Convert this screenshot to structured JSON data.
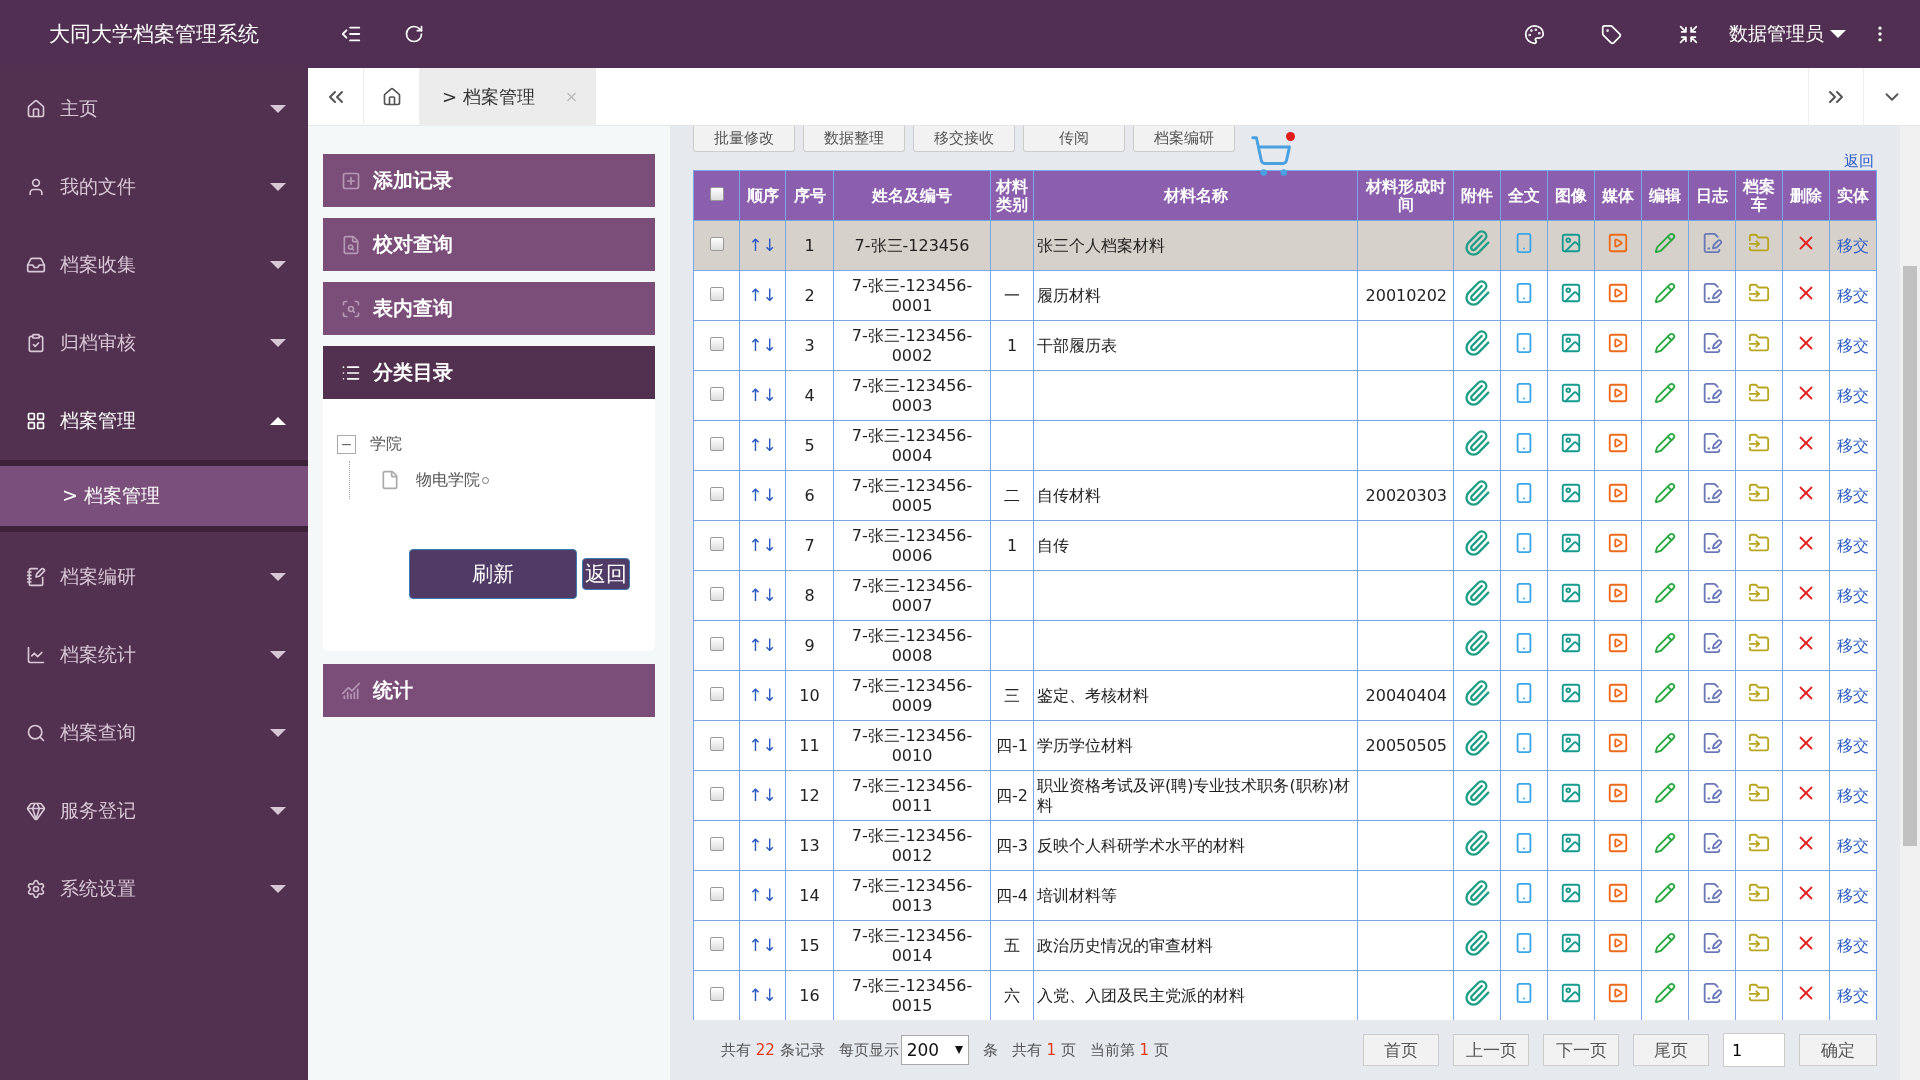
{
  "app_title": "大同大学档案管理系统",
  "user": "数据管理员",
  "sidebar": {
    "items": [
      {
        "label": "主页",
        "expanded": false
      },
      {
        "label": "我的文件",
        "expanded": false
      },
      {
        "label": "档案收集",
        "expanded": false
      },
      {
        "label": "归档审核",
        "expanded": false
      },
      {
        "label": "档案管理",
        "expanded": true,
        "children": [
          {
            "label": "> 档案管理",
            "selected": true
          }
        ]
      },
      {
        "label": "档案编研",
        "expanded": false
      },
      {
        "label": "档案统计",
        "expanded": false
      },
      {
        "label": "档案查询",
        "expanded": false
      },
      {
        "label": "服务登记",
        "expanded": false
      },
      {
        "label": "系统设置",
        "expanded": false
      }
    ]
  },
  "tabs": [
    {
      "label": "> 档案管理",
      "selected": true,
      "close": "×"
    }
  ],
  "panel": {
    "items": [
      {
        "label": "添加记录",
        "selected": false
      },
      {
        "label": "校对查询",
        "selected": false
      },
      {
        "label": "表内查询",
        "selected": false
      },
      {
        "label": "分类目录",
        "selected": true
      },
      {
        "label": "统计",
        "selected": false
      }
    ],
    "tree": [
      {
        "label": "学院",
        "toggle": "−",
        "children": [
          {
            "label": "物电学院"
          }
        ]
      }
    ],
    "buttons": [
      "刷新",
      "返回"
    ]
  },
  "toolbar": [
    "批量修改",
    "数据整理",
    "移交接收",
    "传阅",
    "档案编研"
  ],
  "back_link": "返回",
  "table": {
    "all_checked": false,
    "columns": [
      "顺序",
      "序号",
      "姓名及编号",
      "材料类别",
      "材料名称",
      "材料形成时间",
      "附件",
      "全文",
      "图像",
      "媒体",
      "编辑",
      "日志",
      "档案车",
      "删除",
      "实体"
    ],
    "rows": [
      {
        "selected": true,
        "checked": false,
        "order": "↑↓",
        "no": "1",
        "code": "7-张三-123456",
        "category": "",
        "name": "张三个人档案材料",
        "date": "",
        "action": "移交"
      },
      {
        "selected": false,
        "checked": false,
        "order": "↑↓",
        "no": "2",
        "code": "7-张三-123456-0001",
        "category": "一",
        "name": "履历材料",
        "date": "20010202",
        "action": "移交"
      },
      {
        "selected": false,
        "checked": false,
        "order": "↑↓",
        "no": "3",
        "code": "7-张三-123456-0002",
        "category": "1",
        "name": "干部履历表",
        "date": "",
        "action": "移交"
      },
      {
        "selected": false,
        "checked": false,
        "order": "↑↓",
        "no": "4",
        "code": "7-张三-123456-0003",
        "category": "",
        "name": "",
        "date": "",
        "action": "移交"
      },
      {
        "selected": false,
        "checked": false,
        "order": "↑↓",
        "no": "5",
        "code": "7-张三-123456-0004",
        "category": "",
        "name": "",
        "date": "",
        "action": "移交"
      },
      {
        "selected": false,
        "checked": false,
        "order": "↑↓",
        "no": "6",
        "code": "7-张三-123456-0005",
        "category": "二",
        "name": "自传材料",
        "date": "20020303",
        "action": "移交"
      },
      {
        "selected": false,
        "checked": false,
        "order": "↑↓",
        "no": "7",
        "code": "7-张三-123456-0006",
        "category": "1",
        "name": "自传",
        "date": "",
        "action": "移交"
      },
      {
        "selected": false,
        "checked": false,
        "order": "↑↓",
        "no": "8",
        "code": "7-张三-123456-0007",
        "category": "",
        "name": "",
        "date": "",
        "action": "移交"
      },
      {
        "selected": false,
        "checked": false,
        "order": "↑↓",
        "no": "9",
        "code": "7-张三-123456-0008",
        "category": "",
        "name": "",
        "date": "",
        "action": "移交"
      },
      {
        "selected": false,
        "checked": false,
        "order": "↑↓",
        "no": "10",
        "code": "7-张三-123456-0009",
        "category": "三",
        "name": "鉴定、考核材料",
        "date": "20040404",
        "action": "移交"
      },
      {
        "selected": false,
        "checked": false,
        "order": "↑↓",
        "no": "11",
        "code": "7-张三-123456-0010",
        "category": "四-1",
        "name": "学历学位材料",
        "date": "20050505",
        "action": "移交"
      },
      {
        "selected": false,
        "checked": false,
        "order": "↑↓",
        "no": "12",
        "code": "7-张三-123456-0011",
        "category": "四-2",
        "name": "职业资格考试及评(聘)专业技术职务(职称)材料",
        "date": "",
        "action": "移交"
      },
      {
        "selected": false,
        "checked": false,
        "order": "↑↓",
        "no": "13",
        "code": "7-张三-123456-0012",
        "category": "四-3",
        "name": "反映个人科研学术水平的材料",
        "date": "",
        "action": "移交"
      },
      {
        "selected": false,
        "checked": false,
        "order": "↑↓",
        "no": "14",
        "code": "7-张三-123456-0013",
        "category": "四-4",
        "name": "培训材料等",
        "date": "",
        "action": "移交"
      },
      {
        "selected": false,
        "checked": false,
        "order": "↑↓",
        "no": "15",
        "code": "7-张三-123456-0014",
        "category": "五",
        "name": "政治历史情况的审查材料",
        "date": "",
        "action": "移交"
      },
      {
        "selected": false,
        "checked": false,
        "order": "↑↓",
        "no": "16",
        "code": "7-张三-123456-0015",
        "category": "六",
        "name": "入党、入团及民主党派的材料",
        "date": "",
        "action": "移交"
      }
    ]
  },
  "pagination": {
    "total": [
      "共有",
      "22",
      "条记录"
    ],
    "page_size_label": "每页显示",
    "page_size": "200",
    "page_size_unit": "条",
    "pages": [
      "共有",
      "1",
      "页"
    ],
    "current": [
      "当前第",
      "1",
      "页"
    ],
    "buttons": [
      "首页",
      "上一页",
      "下一页",
      "尾页"
    ],
    "page_input": "1",
    "confirm": "确定"
  }
}
